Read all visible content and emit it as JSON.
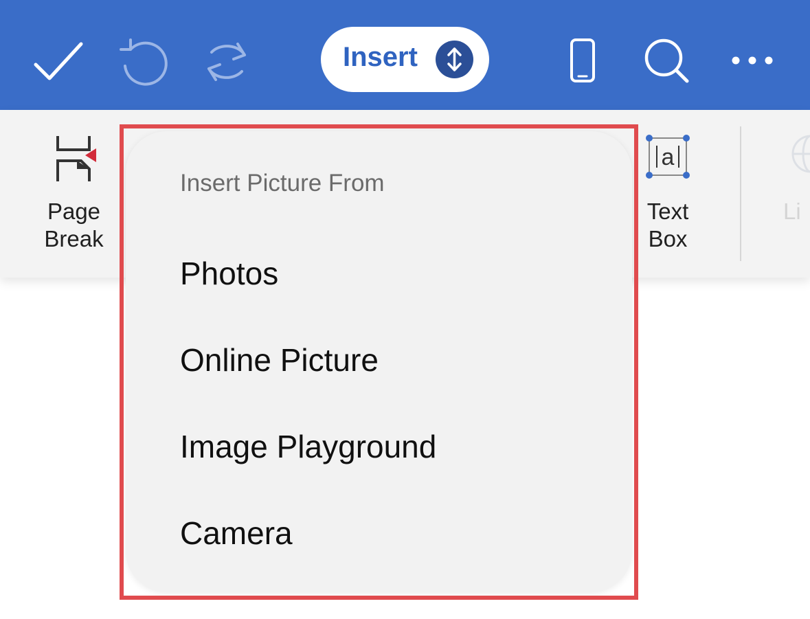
{
  "toolbar": {
    "icons": [
      "checkmark-icon",
      "undo-icon",
      "redo-icon",
      "phone-view-icon",
      "search-icon",
      "more-icon"
    ],
    "active_tab": "Insert",
    "colors": {
      "bar": "#3a6dc8",
      "pill_text": "#2f63c0",
      "toggle": "#2b4f97"
    }
  },
  "ribbon": {
    "page_break_line1": "Page",
    "page_break_line2": "Break",
    "text_box_line1": "Text",
    "text_box_line2": "Box",
    "link_partial": "Li"
  },
  "popover": {
    "title": "Insert Picture From",
    "items": [
      "Photos",
      "Online Picture",
      "Image Playground",
      "Camera"
    ]
  },
  "highlight_color": "#e04b4e"
}
